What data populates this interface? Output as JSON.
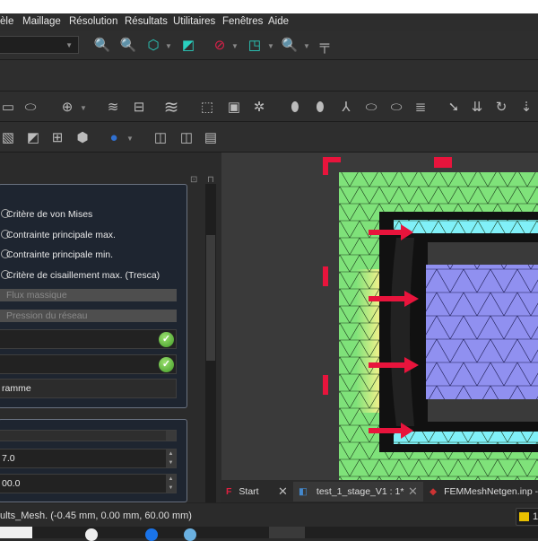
{
  "menubar": {
    "items": [
      "èle",
      "Maillage",
      "Résolution",
      "Résultats",
      "Utilitaires",
      "Fenêtres",
      "Aide"
    ]
  },
  "toolbar1": {
    "combo_value": "",
    "icons": [
      "fit-all-icon",
      "fit-selection-icon",
      "isometric-view-icon",
      "box-zoom-icon",
      "draw-style-icon",
      "selection-view-icon",
      "view-zoom-icon",
      "measure-icon"
    ]
  },
  "panel": {
    "radios": [
      "Critère de von Mises",
      "Contrainte principale max.",
      "Contrainte principale min.",
      "Critère de cisaillement max. (Tresca)"
    ],
    "disabled_options": [
      "Flux massique",
      "Pression du réseau"
    ],
    "fields": [
      "",
      ""
    ],
    "histogram_button": "ramme",
    "slider_value": "",
    "spin1": "7.0",
    "spin2": "00.0"
  },
  "tabs": [
    {
      "label": "Start"
    },
    {
      "label": "test_1_stage_V1 : 1*"
    },
    {
      "label": "FEMMeshNetgen.inp - E"
    }
  ],
  "status": {
    "text": "ults_Mesh. (-0.45 mm, 0.00 mm, 60.00 mm)",
    "indicator": "1"
  },
  "colors": {
    "mesh_green": "#7fe27a",
    "mesh_blue": "#9090f0",
    "mesh_cyan": "#80f0f8",
    "constraint_red": "#e8143c",
    "accent_teal": "#2ad0c0"
  }
}
